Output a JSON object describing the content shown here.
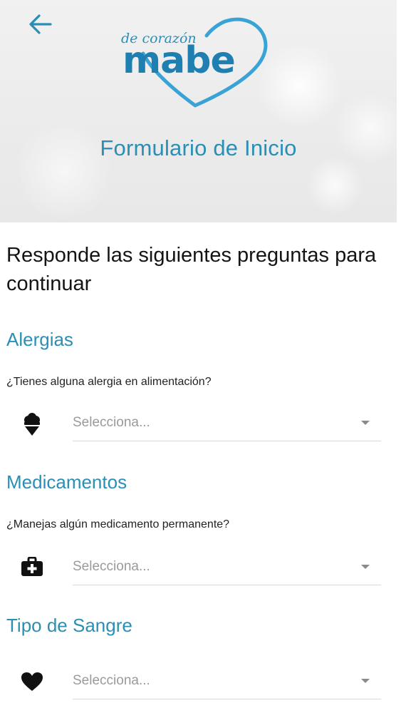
{
  "header": {
    "logo": {
      "tagline": "de corazón",
      "brand": "mabe"
    },
    "title": "Formulario de Inicio"
  },
  "intro": "Responde las siguientes preguntas para continuar",
  "sections": [
    {
      "title": "Alergias",
      "question": "¿Tienes alguna alergia en alimentación?",
      "icon": "ice-cream-icon",
      "placeholder": "Selecciona..."
    },
    {
      "title": "Medicamentos",
      "question": "¿Manejas algún medicamento permanente?",
      "icon": "first-aid-kit-icon",
      "placeholder": "Selecciona..."
    },
    {
      "title": "Tipo de Sangre",
      "question": "",
      "icon": "heart-icon",
      "placeholder": "Selecciona..."
    }
  ],
  "colors": {
    "accent": "#2b8fb5",
    "logo_blue": "#1f7fb0",
    "heart_stroke": "#3aa3d6"
  }
}
